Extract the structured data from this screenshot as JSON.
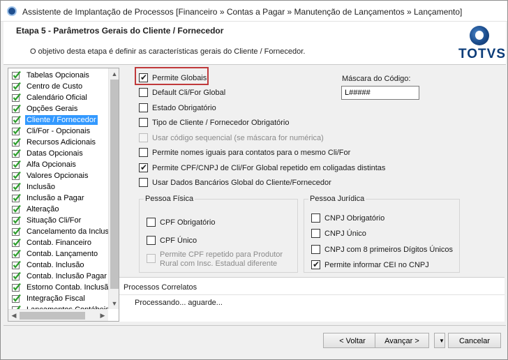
{
  "window": {
    "title": "Assistente de Implantação de Processos [Financeiro » Contas a Pagar » Manutenção de Lançamentos » Lançamento]"
  },
  "header": {
    "step_title": "Etapa 5 - Parâmetros Gerais do Cliente / Fornecedor",
    "description": "O objetivo desta etapa é definir as características gerais do Cliente / Fornecedor.",
    "logo_text": "TOTVS"
  },
  "steps": [
    {
      "label": "Tabelas Opcionais",
      "selected": false
    },
    {
      "label": "Centro de Custo",
      "selected": false
    },
    {
      "label": "Calendário Oficial",
      "selected": false
    },
    {
      "label": "Opções Gerais",
      "selected": false
    },
    {
      "label": "Cliente / Fornecedor",
      "selected": true
    },
    {
      "label": "Cli/For - Opcionais",
      "selected": false
    },
    {
      "label": "Recursos Adicionais",
      "selected": false
    },
    {
      "label": "Datas Opcionais",
      "selected": false
    },
    {
      "label": "Alfa Opcionais",
      "selected": false
    },
    {
      "label": "Valores Opcionais",
      "selected": false
    },
    {
      "label": "Inclusão",
      "selected": false
    },
    {
      "label": "Inclusão a Pagar",
      "selected": false
    },
    {
      "label": "Alteração",
      "selected": false
    },
    {
      "label": "Situação Cli/For",
      "selected": false
    },
    {
      "label": "Cancelamento da Inclusã",
      "selected": false
    },
    {
      "label": "Contab. Financeiro",
      "selected": false
    },
    {
      "label": "Contab. Lançamento",
      "selected": false
    },
    {
      "label": "Contab. Inclusão",
      "selected": false
    },
    {
      "label": "Contab. Inclusão Pagar",
      "selected": false
    },
    {
      "label": "Estorno Contab. Inclusã",
      "selected": false
    },
    {
      "label": "Integração Fiscal",
      "selected": false
    },
    {
      "label": "Lançamentos Contábeis",
      "selected": false
    }
  ],
  "options": {
    "permite_globais": {
      "label": "Permite Globais",
      "checked": true
    },
    "default_clifor_global": {
      "label": "Default Cli/For Global",
      "checked": false
    },
    "estado_obrigatorio": {
      "label": "Estado Obrigatório",
      "checked": false
    },
    "tipo_obrigatorio": {
      "label": "Tipo de Cliente / Fornecedor Obrigatório",
      "checked": false
    },
    "codigo_sequencial": {
      "label": "Usar código sequencial (se máscara for numérica)",
      "checked": false,
      "disabled": true
    },
    "nomes_iguais": {
      "label": "Permite nomes iguais para contatos para o mesmo Cli/For",
      "checked": false
    },
    "cpf_cnpj_repetido": {
      "label": "Permite CPF/CNPJ de Cli/For Global repetido em coligadas distintas",
      "checked": true
    },
    "dados_bancarios": {
      "label": "Usar Dados Bancários Global do Cliente/Fornecedor",
      "checked": false
    }
  },
  "mask": {
    "label": "Máscara do Código:",
    "value": "L#####"
  },
  "pessoa_fisica": {
    "title": "Pessoa Física",
    "cpf_obrigatorio": {
      "label": "CPF Obrigatório",
      "checked": false
    },
    "cpf_unico": {
      "label": "CPF Único",
      "checked": false
    },
    "cpf_repetido": {
      "line1": "Permite CPF repetido para Produtor",
      "line2": "Rural com Insc. Estadual diferente",
      "checked": false,
      "disabled": true
    }
  },
  "pessoa_juridica": {
    "title": "Pessoa Jurídica",
    "cnpj_obrigatorio": {
      "label": "CNPJ Obrigatório",
      "checked": false
    },
    "cnpj_unico": {
      "label": "CNPJ Único",
      "checked": false
    },
    "cnpj_8_digitos": {
      "label": "CNPJ com 8 primeiros Dígitos Únicos",
      "checked": false
    },
    "cei_no_cnpj": {
      "label": "Permite informar CEI no CNPJ",
      "checked": true
    }
  },
  "processos": {
    "title": "Processos Correlatos",
    "status": "Processando... aguarde..."
  },
  "footer": {
    "voltar": "< Voltar",
    "avancar": "Avançar >",
    "dropdown_glyph": "▼",
    "cancelar": "Cancelar"
  },
  "colors": {
    "selection": "#3399ff",
    "highlight_border": "#c0393b",
    "logo_blue": "#0a3b78"
  }
}
